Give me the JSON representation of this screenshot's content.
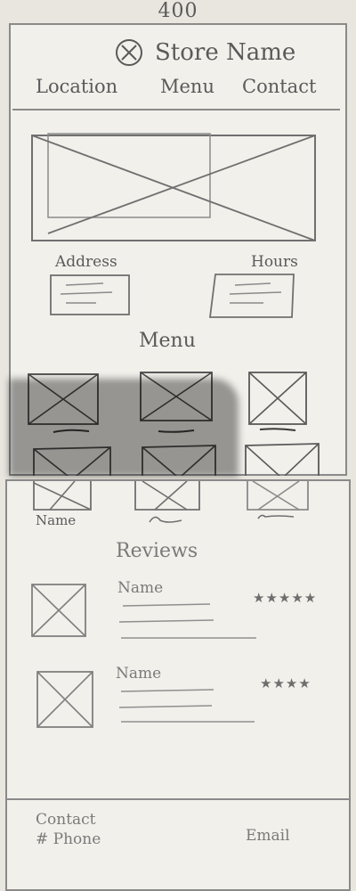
{
  "annotation": {
    "width_label": "400"
  },
  "header": {
    "logo_icon": "x-circle-icon",
    "store_name": "Store Name",
    "nav": [
      "Location",
      "Menu",
      "Contact"
    ]
  },
  "info": {
    "address_label": "Address",
    "hours_label": "Hours"
  },
  "menu": {
    "heading": "Menu",
    "item_name": "Name"
  },
  "reviews": {
    "heading": "Reviews",
    "items": [
      {
        "name": "Name",
        "rating": 5,
        "stars": "★★★★★"
      },
      {
        "name": "Name",
        "rating": 4,
        "stars": "★★★★"
      }
    ]
  },
  "footer": {
    "contact_label": "Contact",
    "phone_label": "# Phone",
    "email_label": "Email"
  }
}
